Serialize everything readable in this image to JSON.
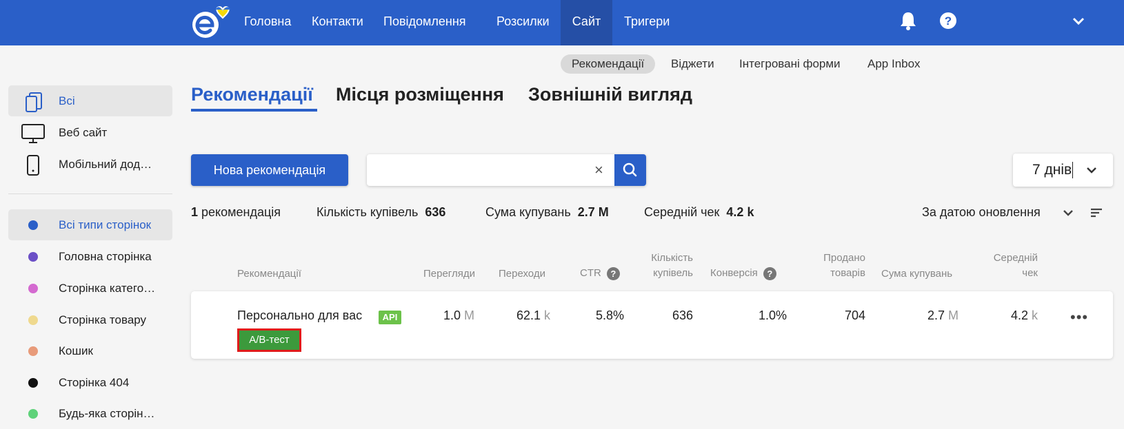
{
  "colors": {
    "primary": "#2a5fc8",
    "badge_api": "#6cc24a",
    "badge_ab": "#3c9a3c",
    "ab_outline": "#e01b1b"
  },
  "topnav": {
    "items": [
      {
        "label": "Головна"
      },
      {
        "label": "Контакти"
      },
      {
        "label": "Повідомлення"
      },
      {
        "label": "Розсилки"
      },
      {
        "label": "Сайт",
        "active": true
      },
      {
        "label": "Тригери"
      }
    ],
    "icons": [
      "logo-icon",
      "bell-icon",
      "help-icon",
      "chevron-down-icon"
    ]
  },
  "subnav": {
    "items": [
      {
        "label": "Рекомендації",
        "active": true
      },
      {
        "label": "Віджети"
      },
      {
        "label": "Інтегровані форми"
      },
      {
        "label": "App Inbox"
      }
    ]
  },
  "sidebar": {
    "platforms": [
      {
        "label": "Всі",
        "icon": "devices-icon",
        "active": true
      },
      {
        "label": "Веб сайт",
        "icon": "monitor-icon"
      },
      {
        "label": "Мобільний дод…",
        "icon": "phone-icon"
      }
    ],
    "page_types": [
      {
        "label": "Всі типи сторінок",
        "color": "#2a5fc8",
        "active": true
      },
      {
        "label": "Головна сторінка",
        "color": "#6b4fc6"
      },
      {
        "label": "Сторінка катего…",
        "color": "#d46ad0"
      },
      {
        "label": "Сторінка товару",
        "color": "#efd98e"
      },
      {
        "label": "Кошик",
        "color": "#e89b7a"
      },
      {
        "label": "Сторінка 404",
        "color": "#111111"
      },
      {
        "label": "Будь-яка сторін…",
        "color": "#5fd27a"
      }
    ]
  },
  "main": {
    "tabs": [
      {
        "label": "Рекомендації",
        "active": true
      },
      {
        "label": "Місця розміщення"
      },
      {
        "label": "Зовнішній вигляд"
      }
    ],
    "new_button": "Нова рекомендація",
    "search": {
      "value": "",
      "placeholder": ""
    },
    "period": "7 днів"
  },
  "summary": {
    "count": "1",
    "count_label": "рекомендація",
    "purchases_label": "Кількість купівель",
    "purchases_value": "636",
    "sum_label": "Сума купувань",
    "sum_value": "2.7 M",
    "avg_label": "Середній чек",
    "avg_value": "4.2 k",
    "sort_label": "За датою оновлення"
  },
  "table": {
    "headers": {
      "name": "Рекомендації",
      "views": "Перегляди",
      "clicks": "Переходи",
      "ctr": "CTR",
      "purchases": [
        "Кількість",
        "купівель"
      ],
      "conversion": "Конверсія",
      "sold": [
        "Продано",
        "товарів"
      ],
      "sum": "Сума купувань",
      "avg": [
        "Середній",
        "чек"
      ]
    },
    "rows": [
      {
        "name": "Персонально для вас",
        "badge": "API",
        "ab_label": "A/B-тест",
        "views": "1.0",
        "views_unit": "M",
        "clicks": "62.1",
        "clicks_unit": "k",
        "ctr": "5.8%",
        "purchases": "636",
        "conversion": "1.0%",
        "sold": "704",
        "sum": "2.7",
        "sum_unit": "M",
        "avg": "4.2",
        "avg_unit": "k"
      }
    ]
  }
}
